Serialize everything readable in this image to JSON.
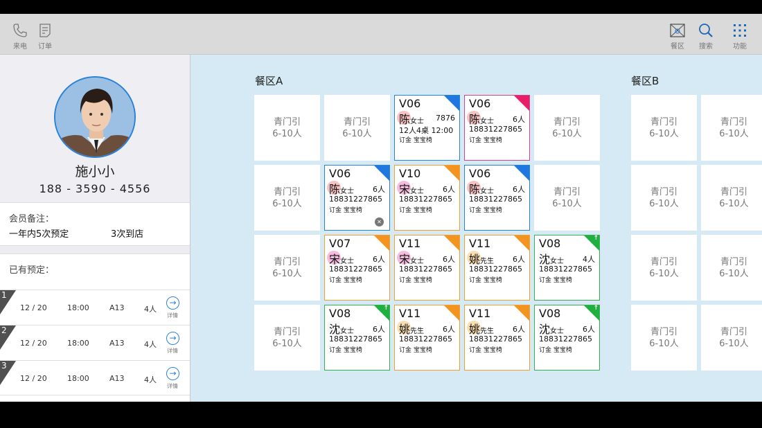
{
  "toolbar": {
    "left": [
      {
        "label": "来电",
        "icon": "phone-icon"
      },
      {
        "label": "订单",
        "icon": "order-icon"
      }
    ],
    "right": [
      {
        "label": "餐区",
        "icon": "dining-area-icon"
      },
      {
        "label": "搜索",
        "icon": "search-icon"
      },
      {
        "label": "功能",
        "icon": "grid-menu-icon"
      }
    ]
  },
  "customer": {
    "name": "施小小",
    "phone": "188 - 3590 - 4556",
    "notes_label": "会员备注：",
    "note_left": "一年内5次预定",
    "note_right": "3次到店",
    "bookings_label": "已有预定：",
    "bookings": [
      {
        "index": "1",
        "date": "12 / 20",
        "time": "18:00",
        "table": "A13",
        "people": "4人",
        "detail": "详情"
      },
      {
        "index": "2",
        "date": "12 / 20",
        "time": "18:00",
        "table": "A13",
        "people": "4人",
        "detail": "详情"
      },
      {
        "index": "3",
        "date": "12 / 20",
        "time": "18:00",
        "table": "A13",
        "people": "4人",
        "detail": "详情"
      }
    ]
  },
  "colors": {
    "blue": "#1e78e0",
    "pink": "#e81e6a",
    "orange": "#f39420",
    "green": "#20b040",
    "accent": "#2a82d8"
  },
  "area_a": {
    "title": "餐区A",
    "cells": [
      {
        "type": "empty",
        "line1": "青门引",
        "line2": "6-10人"
      },
      {
        "type": "empty",
        "line1": "青门引",
        "line2": "6-10人"
      },
      {
        "type": "occ",
        "color": "blue",
        "code": "V06",
        "surname": "陈",
        "honor": "女士",
        "count": "7876",
        "phone": "12人4桌     12:00",
        "tags": "订金  宝宝椅"
      },
      {
        "type": "occ",
        "color": "pink",
        "code": "V06",
        "surname": "陈",
        "honor": "女士",
        "count": "6人",
        "phone": "18831227865",
        "tags": "订金  宝宝椅"
      },
      {
        "type": "empty",
        "line1": "青门引",
        "line2": "6-10人"
      },
      {
        "type": "empty",
        "line1": "青门引",
        "line2": "6-10人"
      },
      {
        "type": "occ",
        "color": "blue",
        "code": "V06",
        "surname": "陈",
        "honor": "女士",
        "count": "6人",
        "phone": "18831227865",
        "tags": "订金  宝宝椅",
        "gear": true
      },
      {
        "type": "occ",
        "color": "orange",
        "code": "V10",
        "surname": "宋",
        "honor": "女士",
        "count": "6人",
        "phone": "18831227865",
        "tags": "订金  宝宝椅"
      },
      {
        "type": "occ",
        "color": "blue",
        "code": "V06",
        "surname": "陈",
        "honor": "女士",
        "count": "6人",
        "phone": "18831227865",
        "tags": "订金  宝宝椅"
      },
      {
        "type": "empty",
        "line1": "青门引",
        "line2": "6-10人"
      },
      {
        "type": "empty",
        "line1": "青门引",
        "line2": "6-10人"
      },
      {
        "type": "occ",
        "color": "orange",
        "code": "V07",
        "surname": "宋",
        "honor": "女士",
        "count": "6人",
        "phone": "18831227865",
        "tags": "订金  宝宝椅"
      },
      {
        "type": "occ",
        "color": "orange",
        "code": "V11",
        "surname": "宋",
        "honor": "女士",
        "count": "6人",
        "phone": "18831227865",
        "tags": "订金  宝宝椅"
      },
      {
        "type": "occ",
        "color": "orange",
        "code": "V11",
        "surname": "姚",
        "honor": "先生",
        "count": "6人",
        "phone": "18831227865",
        "tags": "订金  宝宝椅"
      },
      {
        "type": "occ",
        "color": "green",
        "code": "V08",
        "surname": "沈",
        "honor": "女士",
        "count": "4人",
        "phone": "18831227865",
        "tags": "订金  宝宝椅",
        "arrow": "↑"
      },
      {
        "type": "empty",
        "line1": "青门引",
        "line2": "6-10人"
      },
      {
        "type": "occ",
        "color": "green",
        "code": "V08",
        "surname": "沈",
        "honor": "女士",
        "count": "6人",
        "phone": "18831227865",
        "tags": "订金  宝宝椅",
        "arrow": "↑"
      },
      {
        "type": "occ",
        "color": "orange",
        "code": "V11",
        "surname": "姚",
        "honor": "先生",
        "count": "6人",
        "phone": "18831227865",
        "tags": "订金  宝宝椅"
      },
      {
        "type": "occ",
        "color": "orange",
        "code": "V11",
        "surname": "姚",
        "honor": "先生",
        "count": "6人",
        "phone": "18831227865",
        "tags": "订金  宝宝椅"
      },
      {
        "type": "occ",
        "color": "green",
        "code": "V08",
        "surname": "沈",
        "honor": "女士",
        "count": "6人",
        "phone": "18831227865",
        "tags": "订金  宝宝椅",
        "arrow": "↑"
      }
    ]
  },
  "area_b": {
    "title": "餐区B",
    "cells": [
      {
        "type": "empty",
        "line1": "青门引",
        "line2": "6-10人"
      },
      {
        "type": "empty",
        "line1": "青门引",
        "line2": "6-10人"
      },
      {
        "type": "empty",
        "line1": "青门引",
        "line2": "6-10人"
      },
      {
        "type": "empty",
        "line1": "青门引",
        "line2": "6-10人"
      },
      {
        "type": "empty",
        "line1": "青门引",
        "line2": "6-10人"
      },
      {
        "type": "empty",
        "line1": "青门引",
        "line2": "6-10人"
      },
      {
        "type": "empty",
        "line1": "青门引",
        "line2": "6-10人"
      },
      {
        "type": "empty",
        "line1": "青门引",
        "line2": "6-10人"
      }
    ]
  }
}
